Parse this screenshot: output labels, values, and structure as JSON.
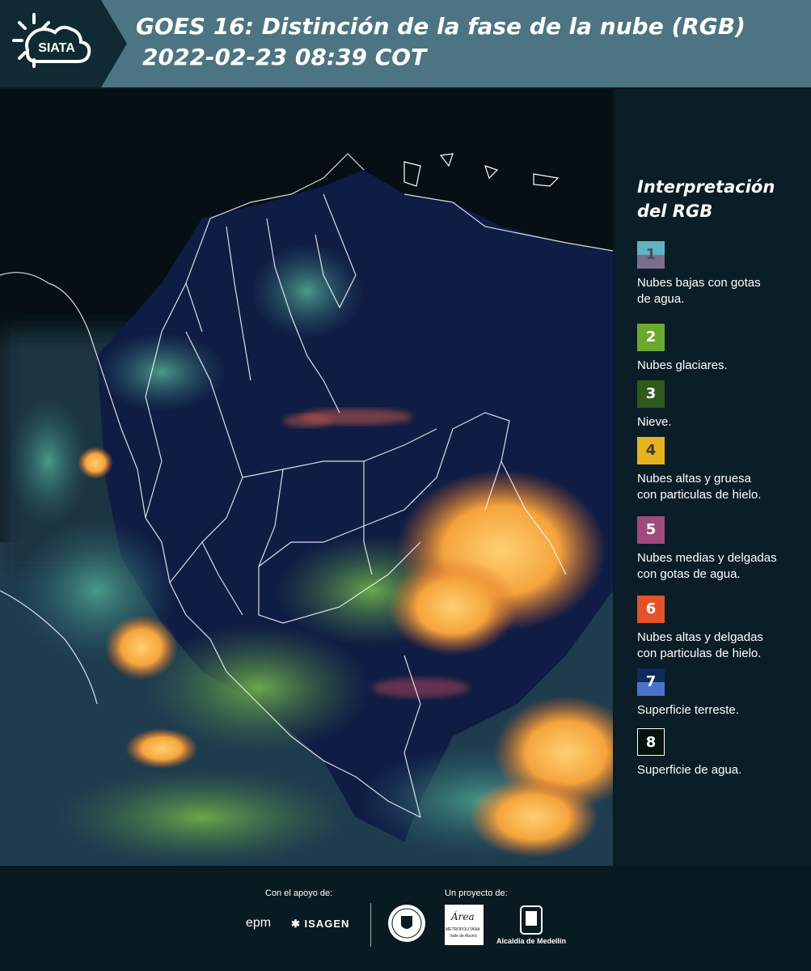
{
  "header": {
    "logo_text": "SIATA",
    "title_line1": "GOES 16: Distinción de la fase de la nube (RGB)",
    "title_line2": "2022-02-23 08:39 COT"
  },
  "legend": {
    "title_line1": "Interpretación",
    "title_line2": "del RGB",
    "items": [
      {
        "num": "1",
        "label_line1": "Nubes bajas con gotas",
        "label_line2": "de agua.",
        "top_color": "#5fb3c2",
        "bottom_color": "#7a6f8e",
        "num_color": "#4a4a5a"
      },
      {
        "num": "2",
        "label_line1": "Nubes glaciares.",
        "label_line2": "",
        "top_color": "#6aa82e",
        "bottom_color": "#6aa82e",
        "num_color": "#ffffff"
      },
      {
        "num": "3",
        "label_line1": "Nieve.",
        "label_line2": "",
        "top_color": "#2e5a1c",
        "bottom_color": "#2e5a1c",
        "num_color": "#ffffff"
      },
      {
        "num": "4",
        "label_line1": "Nubes altas y gruesa",
        "label_line2": "con particulas de hielo.",
        "top_color": "#e8b21e",
        "bottom_color": "#e8b21e",
        "num_color": "#3a3a3a"
      },
      {
        "num": "5",
        "label_line1": "Nubes medias y delgadas",
        "label_line2": "con gotas de agua.",
        "top_color": "#a04a7c",
        "bottom_color": "#a04a7c",
        "num_color": "#ffffff"
      },
      {
        "num": "6",
        "label_line1": "Nubes altas y delgadas",
        "label_line2": "con particulas de hielo.",
        "top_color": "#e4522a",
        "bottom_color": "#e4522a",
        "num_color": "#ffffff"
      },
      {
        "num": "7",
        "label_line1": "Superficie terreste.",
        "label_line2": "",
        "top_color": "#0e2a5e",
        "bottom_color": "#4a72c8",
        "num_color": "#ffffff"
      },
      {
        "num": "8",
        "label_line1": "Superficie de agua.",
        "label_line2": "",
        "top_color": "#05140c",
        "bottom_color": "#05140c",
        "num_color": "#ffffff"
      }
    ]
  },
  "footer": {
    "support_label": "Con el apoyo de:",
    "project_label": "Un proyecto de:",
    "epm": "epm",
    "isagen": "ISAGEN",
    "area_line1": "Área",
    "area_line2": "METROPOLITANA",
    "area_line3": "Valle de Aburrá",
    "alcaldia": "Alcaldía de Medellín"
  },
  "colors": {
    "header_bg": "#4d7482",
    "logo_bg": "#0f2a33",
    "map_bg": "#06121a",
    "legend_bg": "#0b1d27",
    "cloud_high": "#f0a040",
    "land_dark": "#101e48"
  }
}
